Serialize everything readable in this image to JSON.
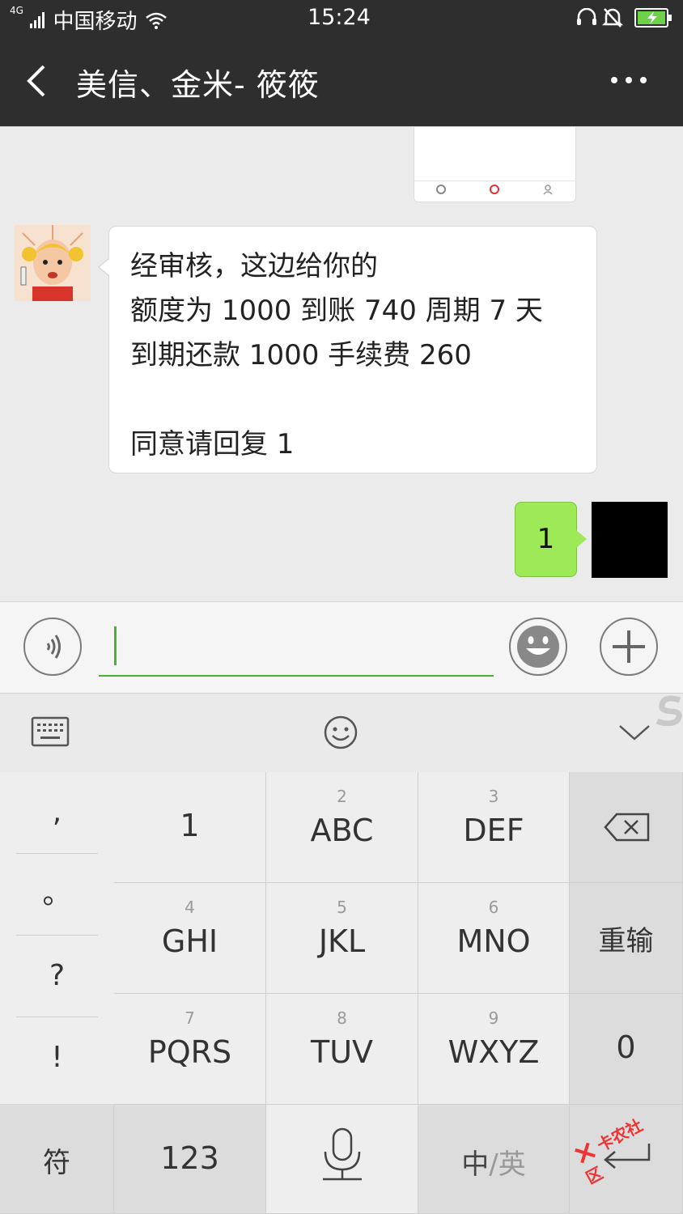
{
  "status_bar": {
    "network": "4G",
    "carrier": "中国移动",
    "time": "15:24"
  },
  "title_bar": {
    "title": "美信、金米- 筱筱"
  },
  "messages": {
    "incoming": {
      "lines": [
        "经审核，这边给你的",
        "额度为 1000 到账 740  周期 7 天",
        "到期还款 1000  手续费 260",
        "",
        "同意请回复 1"
      ]
    },
    "outgoing": {
      "text": "1"
    }
  },
  "keyboard": {
    "punct": [
      ",",
      "。",
      "?",
      "!"
    ],
    "keys": [
      {
        "num": "",
        "label": "1"
      },
      {
        "num": "2",
        "label": "ABC"
      },
      {
        "num": "3",
        "label": "DEF"
      },
      {
        "num": "4",
        "label": "GHI"
      },
      {
        "num": "5",
        "label": "JKL"
      },
      {
        "num": "6",
        "label": "MNO"
      },
      {
        "num": "7",
        "label": "PQRS"
      },
      {
        "num": "8",
        "label": "TUV"
      },
      {
        "num": "9",
        "label": "WXYZ"
      }
    ],
    "reinput": "重输",
    "zero": "0",
    "symbol": "符",
    "numeric": "123",
    "lang_zh": "中",
    "lang_sep": "/",
    "lang_en": "英"
  },
  "watermark": "卡农社区",
  "colors": {
    "header_bg": "#2e2e2e",
    "accent_green": "#9ee958",
    "input_underline": "#4cb035"
  }
}
